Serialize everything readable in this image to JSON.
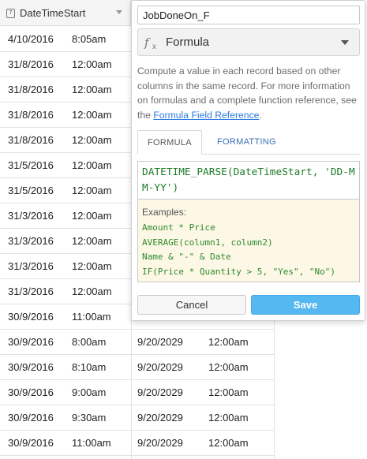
{
  "grid": {
    "column_header": {
      "icon": "calendar-icon",
      "icon_text": "7",
      "label": "DateTimeStart"
    },
    "rows": [
      [
        "4/10/2016",
        "8:05am",
        "",
        ""
      ],
      [
        "31/8/2016",
        "12:00am",
        "",
        ""
      ],
      [
        "31/8/2016",
        "12:00am",
        "",
        ""
      ],
      [
        "31/8/2016",
        "12:00am",
        "",
        ""
      ],
      [
        "31/8/2016",
        "12:00am",
        "",
        ""
      ],
      [
        "31/5/2016",
        "12:00am",
        "",
        ""
      ],
      [
        "31/5/2016",
        "12:00am",
        "",
        ""
      ],
      [
        "31/3/2016",
        "12:00am",
        "",
        ""
      ],
      [
        "31/3/2016",
        "12:00am",
        "",
        ""
      ],
      [
        "31/3/2016",
        "12:00am",
        "",
        ""
      ],
      [
        "31/3/2016",
        "12:00am",
        "",
        ""
      ],
      [
        "30/9/2016",
        "11:00am",
        "",
        ""
      ],
      [
        "30/9/2016",
        "8:00am",
        "9/20/2029",
        "12:00am"
      ],
      [
        "30/9/2016",
        "8:10am",
        "9/20/2029",
        "12:00am"
      ],
      [
        "30/9/2016",
        "9:00am",
        "9/20/2029",
        "12:00am"
      ],
      [
        "30/9/2016",
        "9:30am",
        "9/20/2029",
        "12:00am"
      ],
      [
        "30/9/2016",
        "11:00am",
        "9/20/2029",
        "12:00am"
      ]
    ]
  },
  "popup": {
    "field_name": "JobDoneOn_F",
    "field_type": {
      "icon": "formula-fx-icon",
      "label": "Formula"
    },
    "description_text": "Compute a value in each record based on other columns in the same record. For more information on formulas and a complete function reference, see the ",
    "description_link": "Formula Field Reference",
    "description_end": ".",
    "tabs": [
      {
        "label": "FORMULA",
        "active": true
      },
      {
        "label": "FORMATTING",
        "active": false
      }
    ],
    "formula": "DATETIME_PARSE(DateTimeStart, 'DD-MM-YY')",
    "examples_title": "Examples:",
    "examples": [
      "Amount * Price",
      "AVERAGE(column1, column2)",
      "Name & \"-\" & Date",
      "IF(Price * Quantity > 5, \"Yes\", \"No\")"
    ],
    "cancel_label": "Cancel",
    "save_label": "Save"
  },
  "colors": {
    "save_button": "#56b8f0",
    "link": "#2a7bdf",
    "formula_text": "#1d7a26",
    "examples_bg": "#fdf7e6"
  }
}
